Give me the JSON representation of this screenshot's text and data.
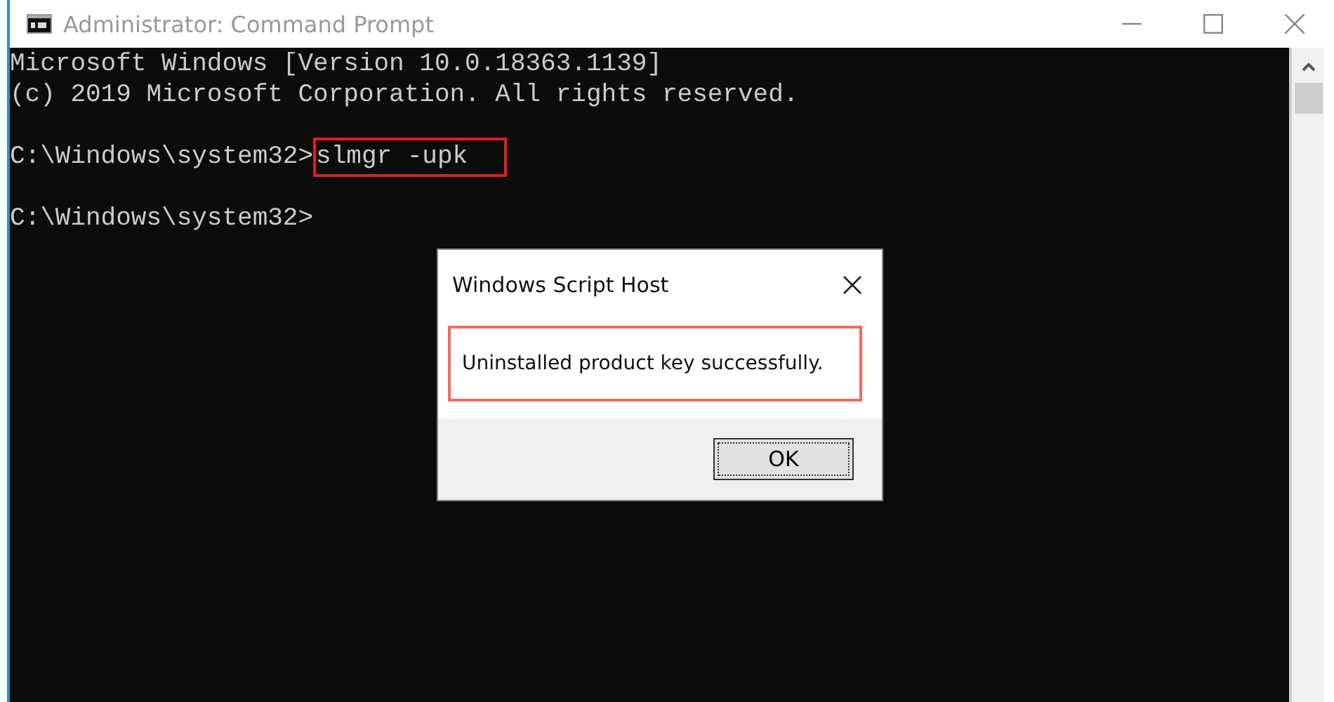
{
  "window": {
    "title": "Administrator: Command Prompt"
  },
  "console": {
    "lines": [
      {
        "kind": "text",
        "text": "Microsoft Windows [Version 10.0.18363.1139]"
      },
      {
        "kind": "text",
        "text": "(c) 2019 Microsoft Corporation. All rights reserved."
      },
      {
        "kind": "blank"
      },
      {
        "kind": "command",
        "prompt": "C:\\Windows\\system32>",
        "command": "slmgr -upk",
        "highlighted": true
      },
      {
        "kind": "blank"
      },
      {
        "kind": "command",
        "prompt": "C:\\Windows\\system32>"
      }
    ]
  },
  "dialog": {
    "title": "Windows Script Host",
    "message": "Uninstalled product key successfully.",
    "message_highlighted": true,
    "buttons": [
      "OK"
    ]
  }
}
